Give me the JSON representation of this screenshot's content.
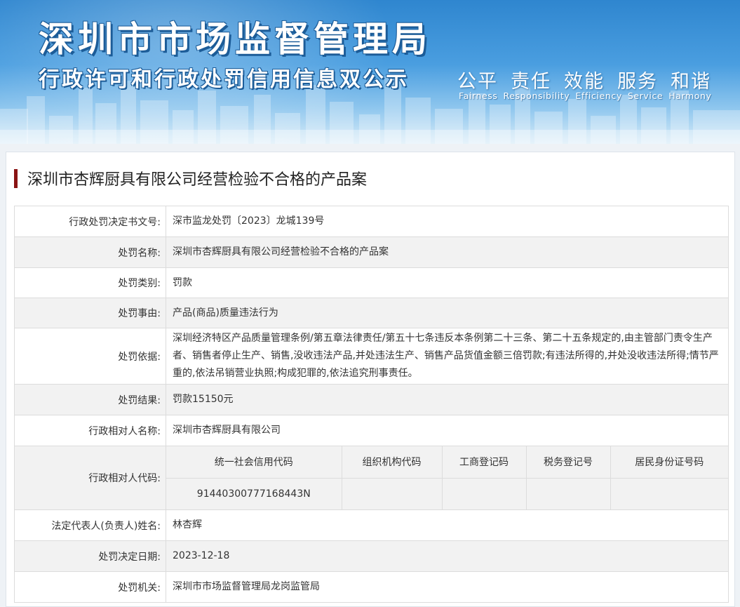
{
  "header": {
    "agency": "深圳市市场监督管理局",
    "subtitle": "行政许可和行政处罚信用信息双公示",
    "motto_cn": [
      "公平",
      "责任",
      "效能",
      "服务",
      "和谐"
    ],
    "motto_en": [
      "Fairness",
      "Responsibility",
      "Efficiency",
      "Service",
      "Harmony"
    ]
  },
  "case_title": "深圳市杏辉厨具有限公司经营检验不合格的产品案",
  "rows": [
    {
      "label": "行政处罚决定书文号:",
      "value": "深市监龙处罚〔2023〕龙城139号"
    },
    {
      "label": "处罚名称:",
      "value": "深圳市杏辉厨具有限公司经营检验不合格的产品案"
    },
    {
      "label": "处罚类别:",
      "value": "罚款"
    },
    {
      "label": "处罚事由:",
      "value": "产品(商品)质量违法行为"
    },
    {
      "label": "处罚依据:",
      "value": "深圳经济特区产品质量管理条例/第五章法律责任/第五十七条违反本条例第二十三条、第二十五条规定的,由主管部门责令生产者、销售者停止生产、销售,没收违法产品,并处违法生产、销售产品货值金额三倍罚款;有违法所得的,并处没收违法所得;情节严重的,依法吊销营业执照;构成犯罪的,依法追究刑事责任。"
    },
    {
      "label": "处罚结果:",
      "value": "罚款15150元"
    },
    {
      "label": "行政相对人名称:",
      "value": "深圳市杏辉厨具有限公司"
    }
  ],
  "codes": {
    "label": "行政相对人代码:",
    "headers": [
      "统一社会信用代码",
      "组织机构代码",
      "工商登记码",
      "税务登记号",
      "居民身份证号码"
    ],
    "values": [
      "91440300777168443N",
      "",
      "",
      "",
      ""
    ]
  },
  "rows_after": [
    {
      "label": "法定代表人(负责人)姓名:",
      "value": "林杏辉"
    },
    {
      "label": "处罚决定日期:",
      "value": "2023-12-18"
    },
    {
      "label": "处罚机关:",
      "value": "深圳市市场监督管理局龙岗监管局"
    }
  ]
}
